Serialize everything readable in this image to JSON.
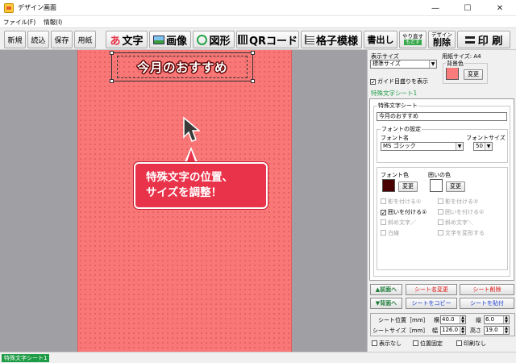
{
  "window": {
    "title": "デザイン画面",
    "minimize": "—",
    "maximize": "☐",
    "close": "✕"
  },
  "menu": [
    "ファイル(F)",
    "情報(I)"
  ],
  "toolbar": {
    "new": "新規",
    "open": "読込",
    "save": "保存",
    "paper": "用紙",
    "text_icon": "あ",
    "text": "文字",
    "image": "画像",
    "shape": "図形",
    "qr": "QRコード",
    "grid": "格子模様",
    "write_out": "書出し",
    "undo_top": "やり直す",
    "undo_badge": "もとす",
    "delete_top": "デザイン",
    "delete": "削除",
    "print": "印 刷"
  },
  "canvas": {
    "text_object": "今月のおすすめ",
    "callout_line1": "特殊文字の位置、",
    "callout_line2": "サイズを調整！",
    "page_color": "#fa7777",
    "callout_color": "#e8334a"
  },
  "panel": {
    "display_size_label": "表示サイズ",
    "display_size_value": "標準サイズ",
    "paper_size_label": "用紙サイズ: A4",
    "background_label": "背景色",
    "background_color": "#f97c7c",
    "change": "変更",
    "guide_label": "ガイド目盛りを表示",
    "tab_title": "特殊文字シート1",
    "sheet_group": "特殊文字シート",
    "sheet_text": "今月のおすすめ",
    "font_group": "フォントの設定",
    "font_name_label": "フォント名",
    "font_name_value": "MS ゴシック",
    "font_size_label": "フォントサイズ",
    "font_size_value": "50",
    "font_color_label": "フォント色",
    "font_color": "#4a0000",
    "border_color_label": "囲いの色",
    "border_color": "#ffffff",
    "options": [
      {
        "label": "影を付ける①",
        "checked": false,
        "enabled": false
      },
      {
        "label": "影を付ける②",
        "checked": false,
        "enabled": false
      },
      {
        "label": "囲いを付ける①",
        "checked": true,
        "enabled": true
      },
      {
        "label": "囲いを付ける②",
        "checked": false,
        "enabled": false
      },
      {
        "label": "斜め文字／",
        "checked": false,
        "enabled": false
      },
      {
        "label": "斜め文字＼",
        "checked": false,
        "enabled": false
      },
      {
        "label": "白線",
        "checked": false,
        "enabled": false
      },
      {
        "label": "文字を変形する",
        "checked": false,
        "enabled": false
      }
    ],
    "front": "▲前面へ",
    "back": "▼背面へ",
    "rename": "シート名変更",
    "delete_sheet": "シート削除",
    "copy_sheet": "シートをコピー",
    "paste_sheet": "シートを貼付",
    "sheet_pos_label": "シート位置［mm］",
    "sheet_size_label": "シートサイズ［mm］",
    "x_label": "横",
    "x_value": "40.0",
    "y_label": "縦",
    "y_value": "6.0",
    "w_label": "幅",
    "w_value": "126.0",
    "h_label": "高さ",
    "h_value": "19.0",
    "hide_label": "表示なし",
    "fix_label": "位置固定",
    "noprint_label": "印刷なし"
  },
  "status": {
    "text": "特殊文字シート1"
  }
}
